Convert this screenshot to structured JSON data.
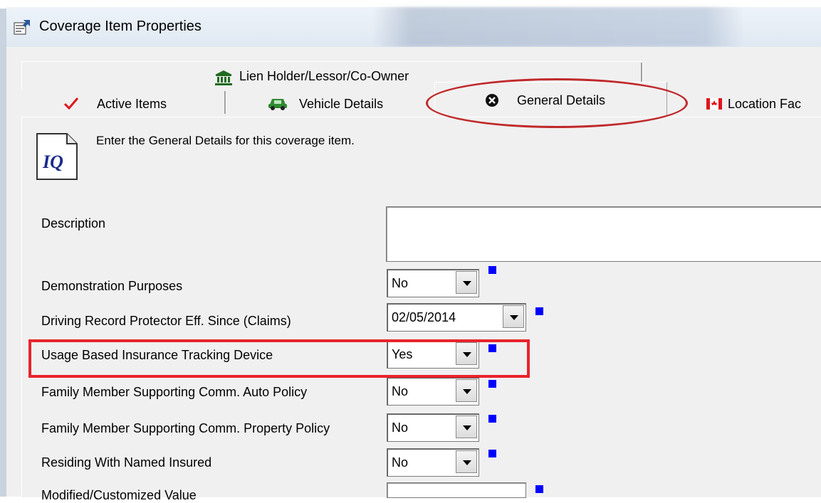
{
  "window": {
    "title": "Coverage Item Properties"
  },
  "tabs": {
    "back_row": [
      {
        "label": "Lien Holder/Lessor/Co-Owner",
        "icon": "bank-icon"
      }
    ],
    "front_row": [
      {
        "label": "Active Items",
        "icon": "checkmark-icon"
      },
      {
        "label": "Vehicle Details",
        "icon": "car-icon"
      },
      {
        "label": "General Details",
        "icon": "close-circle-icon",
        "selected": true
      },
      {
        "label": "Location Fac",
        "icon": "canada-flag-icon"
      }
    ]
  },
  "intro": {
    "text": "Enter the General Details for this coverage item.",
    "icon_text": "IQ"
  },
  "fields": [
    {
      "label": "Description",
      "value": ""
    },
    {
      "label": "Demonstration Purposes",
      "value": "No"
    },
    {
      "label": "Driving Record Protector Eff. Since (Claims)",
      "value": "02/05/2014"
    },
    {
      "label": "Usage Based Insurance Tracking Device",
      "value": "Yes"
    },
    {
      "label": "Family Member Supporting Comm. Auto Policy",
      "value": "No"
    },
    {
      "label": "Family Member Supporting Comm. Property Policy",
      "value": "No"
    },
    {
      "label": "Residing With Named Insured",
      "value": "No"
    },
    {
      "label": "Modified/Customized Value",
      "value": ""
    }
  ],
  "colors": {
    "highlight": "#e8242b",
    "required_marker": "#0000ff",
    "title_bar": "#dfe8f2"
  }
}
